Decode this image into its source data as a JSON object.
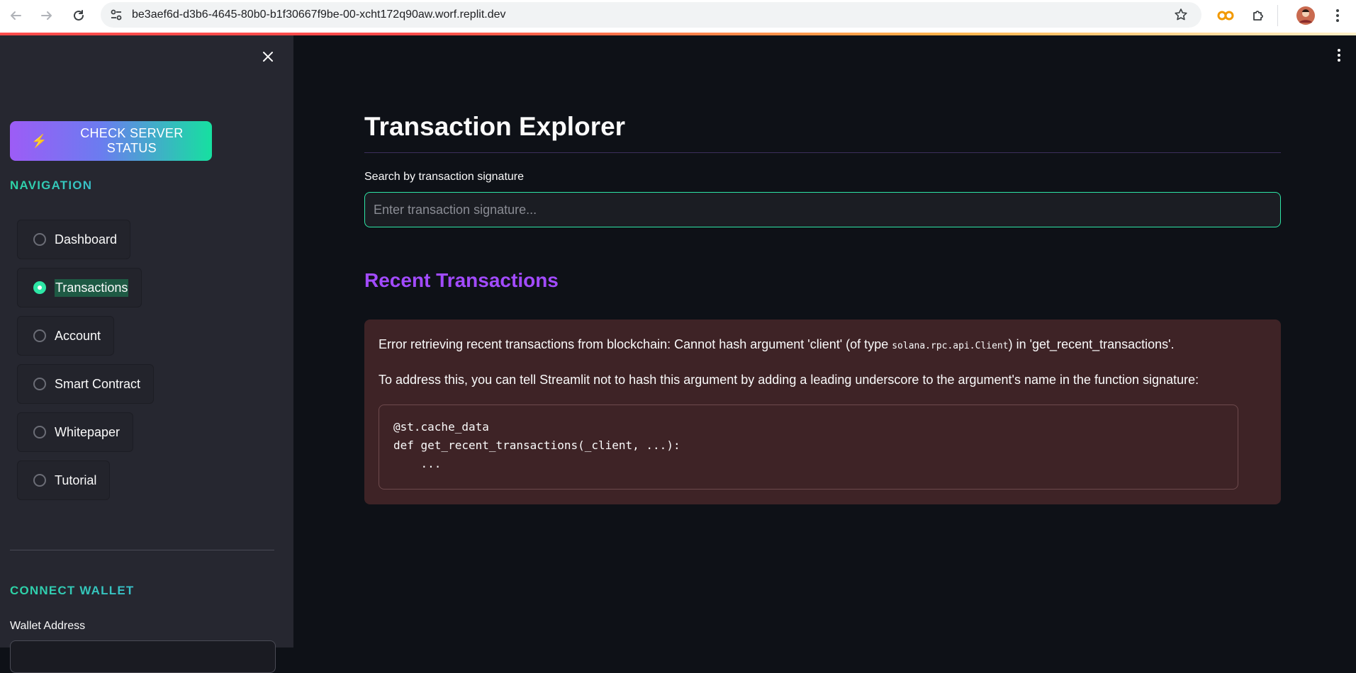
{
  "browser": {
    "url": "be3aef6d-d3b6-4645-80b0-b1f30667f9be-00-xcht172q90aw.worf.replit.dev"
  },
  "sidebar": {
    "server_button_label": "CHECK SERVER STATUS",
    "navigation_title": "NAVIGATION",
    "nav_items": [
      {
        "label": "Dashboard",
        "selected": false
      },
      {
        "label": "Transactions",
        "selected": true
      },
      {
        "label": "Account",
        "selected": false
      },
      {
        "label": "Smart Contract",
        "selected": false
      },
      {
        "label": "Whitepaper",
        "selected": false
      },
      {
        "label": "Tutorial",
        "selected": false
      }
    ],
    "connect_wallet_title": "CONNECT WALLET",
    "wallet_address_label": "Wallet Address"
  },
  "main": {
    "title": "Transaction Explorer",
    "search_label": "Search by transaction signature",
    "search_placeholder": "Enter transaction signature...",
    "recent_title": "Recent Transactions",
    "error": {
      "line1_prefix": "Error retrieving recent transactions from blockchain: Cannot hash argument 'client' (of type ",
      "line1_code": "solana.rpc.api.Client",
      "line1_suffix": ") in 'get_recent_transactions'.",
      "line2": "To address this, you can tell Streamlit not to hash this argument by adding a leading underscore to the argument's name in the function signature:",
      "code": "@st.cache_data\ndef get_recent_transactions(_client, ...):\n    ..."
    }
  },
  "colors": {
    "accent_green": "#2ee6a6",
    "accent_purple": "#a24bff",
    "sidebar_bg": "#262730",
    "main_bg": "#0e1117",
    "error_bg": "#3e2326"
  },
  "icons": [
    "back-arrow-icon",
    "forward-arrow-icon",
    "reload-icon",
    "site-settings-icon",
    "bookmark-star-icon",
    "extension-icon",
    "puzzle-icon",
    "profile-avatar",
    "browser-menu-icon",
    "close-icon",
    "lightning-icon",
    "more-options-icon"
  ]
}
